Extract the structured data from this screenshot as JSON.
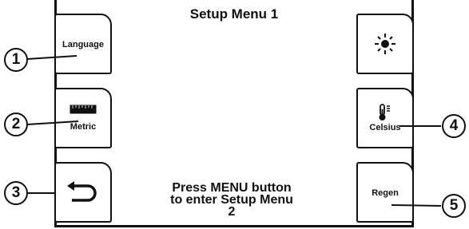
{
  "title": "Setup Menu 1",
  "buttons": {
    "language": {
      "label": "Language"
    },
    "metric": {
      "label": "Metric"
    },
    "back": {
      "label": ""
    },
    "brightness": {
      "label": ""
    },
    "celsius": {
      "label": "Celsius"
    },
    "regen": {
      "label": "Regen"
    }
  },
  "message": {
    "line1": "Press MENU button",
    "line2": "to enter Setup Menu",
    "line3": "2"
  },
  "callouts": [
    "1",
    "2",
    "3",
    "4",
    "5"
  ]
}
